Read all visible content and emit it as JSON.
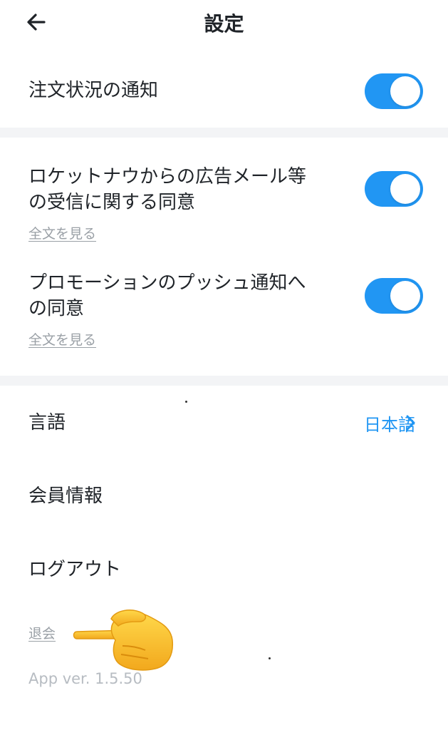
{
  "header": {
    "title": "設定",
    "back_icon": "arrow-left-icon"
  },
  "order_status": {
    "label": "注文状況の通知",
    "enabled": true
  },
  "ad_mail": {
    "label_line1": "ロケットナウからの広告メール等",
    "label_line2": "の受信に関する同意",
    "link": "全文を見る",
    "enabled": true
  },
  "promo_push": {
    "label_line1": "プロモーションのプッシュ通知へ",
    "label_line2": "の同意",
    "link": "全文を見る",
    "enabled": true
  },
  "language": {
    "label": "言語",
    "value": "日本語",
    "chevron_icon": "chevron-right-icon"
  },
  "member_info": {
    "label": "会員情報"
  },
  "logout": {
    "label": "ログアウト"
  },
  "withdraw": {
    "label": "退会"
  },
  "version": {
    "text": "App ver. 1.5.50"
  },
  "colors": {
    "accent": "#2196f3",
    "separator": "#f3f4f6",
    "muted": "#9aa0a6"
  },
  "annotation": {
    "icon": "pointing-hand-icon"
  }
}
